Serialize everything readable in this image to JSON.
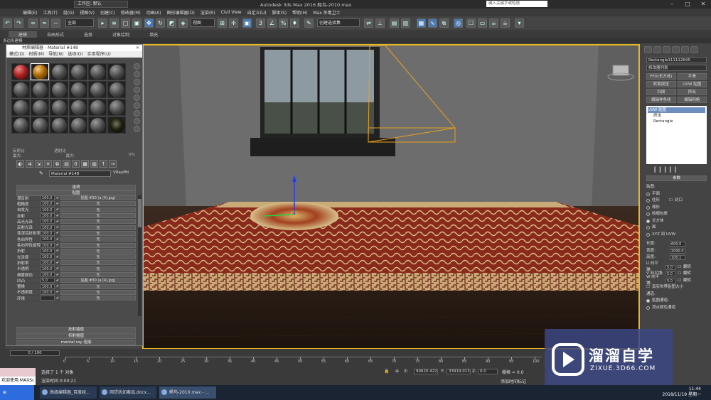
{
  "titlebar": {
    "workspace": "工作区: 默认",
    "app_title": "Autodesk 3ds Max 2016      鳄鸟-2010.max",
    "search_placeholder": "键入关键字或短语"
  },
  "menubar": [
    "编辑(E)",
    "工具(T)",
    "组(G)",
    "视图(V)",
    "创建(C)",
    "修改器(M)",
    "动画(A)",
    "图形编辑器(D)",
    "渲染(R)",
    "Civil View",
    "自定义(U)",
    "脚本(S)",
    "帮助(H)",
    "Max 杀毒卫士"
  ],
  "toolbar": {
    "selset": "全部",
    "viewref": "视图",
    "named_sel": "创建选择集"
  },
  "ribbon": {
    "tabs": [
      "建模",
      "自由形式",
      "选择",
      "对象绘制",
      "填充"
    ],
    "sub": "多边形建模"
  },
  "material_editor": {
    "title": "材质编辑器 - Material #148",
    "menu": [
      "模式(D)",
      "材质(M)",
      "导航(N)",
      "选项(O)",
      "实用程序(U)"
    ],
    "reflection": "反射比",
    "refraction": "透射比",
    "max": "最大:",
    "avg": "平均:",
    "diffuse": "漫反射:",
    "pct": "0%",
    "mat_name": "Material #148",
    "mat_type": "VRayMtl",
    "rollouts_top": [
      "选项",
      "贴图"
    ],
    "maps": [
      {
        "label": "漫反射",
        "amount": "100.0",
        "map": "贴图 #30 (a (4).jpg)"
      },
      {
        "label": "粗糙度",
        "amount": "100.0",
        "map": "无"
      },
      {
        "label": "自发光",
        "amount": "100.0",
        "map": "无"
      },
      {
        "label": "反射",
        "amount": "100.0",
        "map": "无"
      },
      {
        "label": "高光光泽",
        "amount": "100.0",
        "map": "无"
      },
      {
        "label": "反射光泽",
        "amount": "100.0",
        "map": "无"
      },
      {
        "label": "菲涅耳折射率",
        "amount": "100.0",
        "map": "无"
      },
      {
        "label": "各向异性",
        "amount": "100.0",
        "map": "无"
      },
      {
        "label": "各向异性旋转",
        "amount": "100.0",
        "map": "无"
      },
      {
        "label": "折射",
        "amount": "100.0",
        "map": "无"
      },
      {
        "label": "光泽度",
        "amount": "100.0",
        "map": "无"
      },
      {
        "label": "折射率",
        "amount": "100.0",
        "map": "无"
      },
      {
        "label": "半透明",
        "amount": "100.0",
        "map": "无"
      },
      {
        "label": "烟雾颜色",
        "amount": "100.0",
        "map": "无"
      },
      {
        "label": "凹凸",
        "amount": "5.0",
        "map": "贴图 #30 (a (4).jpg)"
      },
      {
        "label": "置换",
        "amount": "100.0",
        "map": "无"
      },
      {
        "label": "不透明度",
        "amount": "100.0",
        "map": "无"
      },
      {
        "label": "环境",
        "amount": "",
        "map": "无"
      }
    ],
    "rollouts_bottom": [
      "反射插值",
      "折射插值",
      "mental ray 连接"
    ]
  },
  "command_panel": {
    "object_name": "Rectangle111112645",
    "modifier_list": "修改器列表",
    "buttons": [
      "FFD(长方体)",
      "平滑",
      "转换按钮",
      "UVW 贴图",
      "扫描",
      "挤出",
      "编辑样条线",
      "编辑网格"
    ],
    "stack": [
      "UVW 贴图",
      "挤出",
      "Rectangle"
    ],
    "params_title": "参数",
    "mapping_label": "贴图:",
    "mapping": [
      "平面",
      "柱形",
      "球形",
      "收缩包裹",
      "长方体",
      "面",
      "XYZ 到 UVW"
    ],
    "mapping_selected": "长方体",
    "cap_label": "封口",
    "length": {
      "label": "长度:",
      "value": "600.0"
    },
    "width": {
      "label": "宽度:",
      "value": "2000.0"
    },
    "height": {
      "label": "高度:",
      "value": "100.1"
    },
    "u_tile": {
      "label": "U 向平铺:",
      "value": "5.0",
      "flip": "翻转"
    },
    "v_tile": {
      "label": "V 向平铺:",
      "value": "5.0",
      "flip": "翻转"
    },
    "w_tile": {
      "label": "W 向平铺:",
      "value": "5.0",
      "flip": "翻转"
    },
    "real_world": "真实世界贴图大小",
    "channel_label": "通道:",
    "map_channel": "贴图通道:",
    "vertex_channel": "顶点颜色通道"
  },
  "timeline": {
    "frame": "0 / 100",
    "ticks": [
      "0",
      "5",
      "10",
      "15",
      "20",
      "25",
      "30",
      "35",
      "40",
      "45",
      "50",
      "55",
      "60",
      "65",
      "70",
      "75",
      "80",
      "85",
      "90",
      "95",
      "100"
    ]
  },
  "status": {
    "welcome": "欢迎使用 MAXSc",
    "selected": "选择了 1 个 对象",
    "render_time": "渲染时间 0:00:21",
    "x": "90620.422",
    "y": "33919.013",
    "z": "0.0",
    "grid": "栅格 = 0.0",
    "add_tag": "添加时间标记"
  },
  "taskbar": {
    "start": "",
    "apps": [
      "高级编辑器_百度经...",
      "网贷犹如毒品.docx...",
      "鳄鸟-2010.max - ..."
    ],
    "time": "11:44",
    "date": "2018/11/19 星期一"
  },
  "watermark": {
    "brand": "溜溜自学",
    "url": "ZIXUE.3D66.COM"
  }
}
